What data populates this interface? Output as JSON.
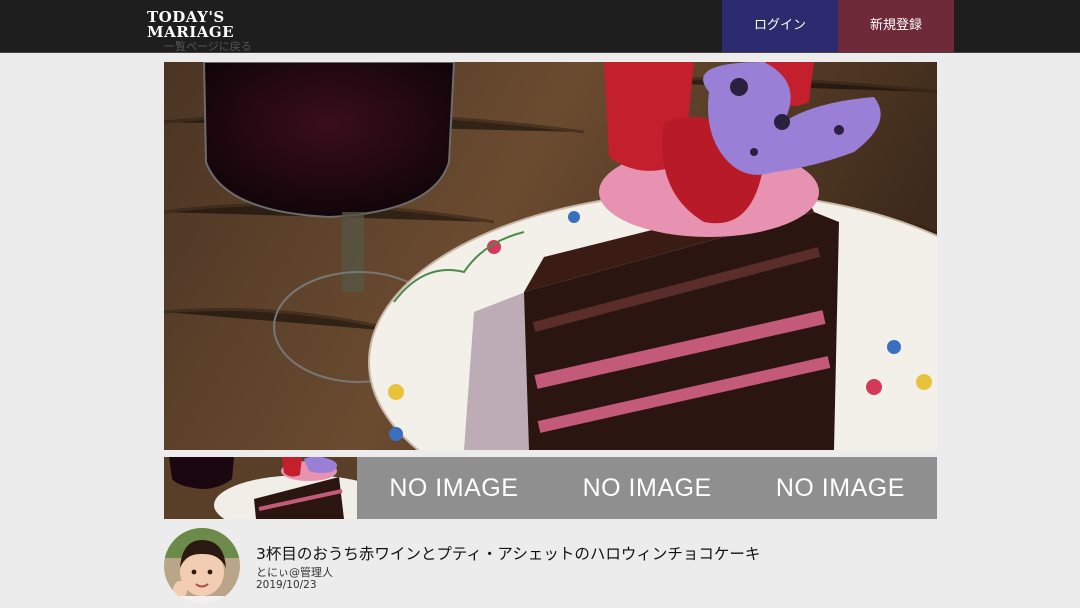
{
  "header": {
    "logo_line1": "TODAY'S",
    "logo_line2": "MARIAGE",
    "login_label": "ログイン",
    "signup_label": "新規登録"
  },
  "nav": {
    "back_label": "一覧ページに戻る"
  },
  "gallery": {
    "no_image_label": "NO IMAGE"
  },
  "post": {
    "title": "3杯目のおうち赤ワインとプティ・アシェットのハロウィンチョコケーキ",
    "author": "とにぃ@管理人",
    "date": "2019/10/23"
  }
}
